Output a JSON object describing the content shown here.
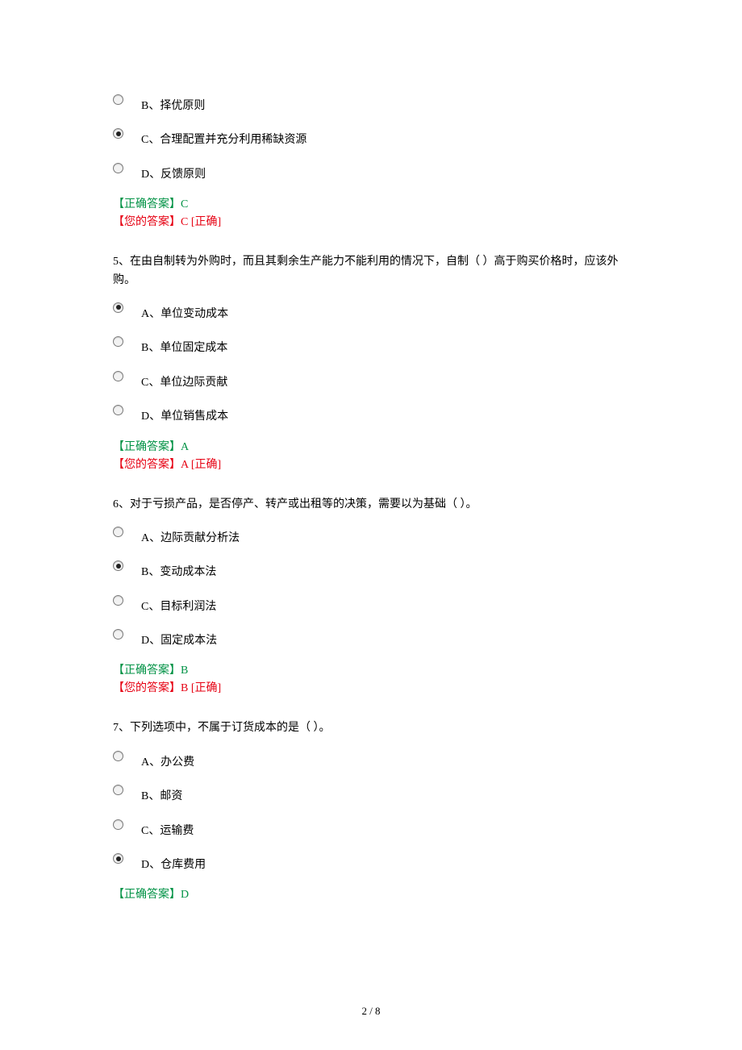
{
  "footer": "2 / 8",
  "partial_q4": {
    "options": [
      {
        "label": "B、择优原则",
        "selected": false
      },
      {
        "label": "C、合理配置并充分利用稀缺资源",
        "selected": true
      },
      {
        "label": "D、反馈原则",
        "selected": false
      }
    ],
    "correct_line": "【正确答案】C",
    "your_line": "【您的答案】C   [正确]"
  },
  "q5": {
    "text": "5、在由自制转为外购时，而且其剩余生产能力不能利用的情况下，自制（   ）高于购买价格时，应该外购。",
    "options": [
      {
        "label": "A、单位变动成本",
        "selected": true
      },
      {
        "label": "B、单位固定成本",
        "selected": false
      },
      {
        "label": "C、单位边际贡献",
        "selected": false
      },
      {
        "label": "D、单位销售成本",
        "selected": false
      }
    ],
    "correct_line": "【正确答案】A",
    "your_line": "【您的答案】A   [正确]"
  },
  "q6": {
    "text": "6、对于亏损产品，是否停产、转产或出租等的决策，需要以为基础（   ）。",
    "options": [
      {
        "label": "A、边际贡献分析法",
        "selected": false
      },
      {
        "label": "B、变动成本法",
        "selected": true
      },
      {
        "label": "C、目标利润法",
        "selected": false
      },
      {
        "label": "D、固定成本法",
        "selected": false
      }
    ],
    "correct_line": "【正确答案】B",
    "your_line": "【您的答案】B   [正确]"
  },
  "q7": {
    "text": "7、下列选项中，不属于订货成本的是（   ）。",
    "options": [
      {
        "label": "A、办公费",
        "selected": false
      },
      {
        "label": "B、邮资",
        "selected": false
      },
      {
        "label": "C、运输费",
        "selected": false
      },
      {
        "label": "D、仓库费用",
        "selected": true
      }
    ],
    "correct_line": "【正确答案】D"
  }
}
